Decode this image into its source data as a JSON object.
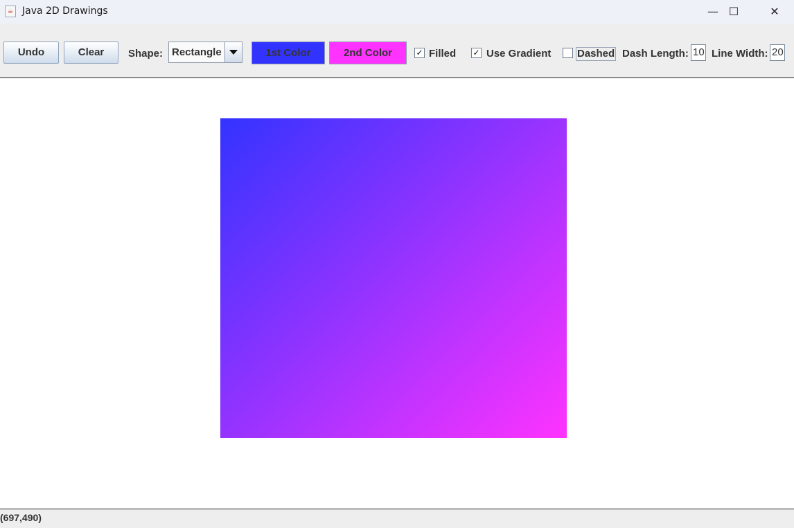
{
  "window": {
    "title": "Java 2D Drawings",
    "controls": {
      "minimize": "—",
      "maximize": "☐",
      "close": "✕"
    }
  },
  "toolbar": {
    "undo_label": "Undo",
    "clear_label": "Clear",
    "shape_label": "Shape:",
    "shape_value": "Rectangle",
    "color1_label": "1st Color",
    "color1": "#3333ff",
    "color2_label": "2nd Color",
    "color2": "#ff33ff",
    "filled_label": "Filled",
    "filled_checked": true,
    "gradient_label": "Use Gradient",
    "gradient_checked": true,
    "dashed_label": "Dashed",
    "dashed_checked": false,
    "dash_length_label": "Dash Length:",
    "dash_length_value": "10",
    "line_width_label": "Line Width:",
    "line_width_value": "20"
  },
  "canvas": {
    "shape": "rectangle",
    "gradient_start": "#3333ff",
    "gradient_end": "#ff33ff"
  },
  "status": {
    "mouse_position": "(697,490)"
  }
}
